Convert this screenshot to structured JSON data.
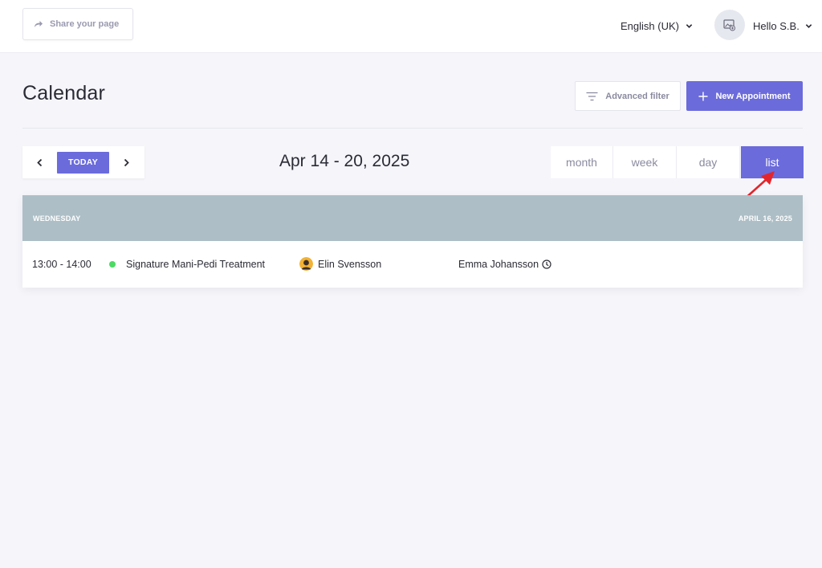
{
  "topbar": {
    "share_label": "Share your page",
    "language": "English (UK)",
    "greeting": "Hello S.B."
  },
  "header": {
    "title": "Calendar",
    "advanced_filter_label": "Advanced filter",
    "new_appointment_label": "New Appointment"
  },
  "toolbar": {
    "today_label": "TODAY",
    "date_range": "Apr 14 - 20, 2025",
    "views": [
      "month",
      "week",
      "day",
      "list"
    ],
    "active_view": "list"
  },
  "list": {
    "day_name": "WEDNESDAY",
    "day_date": "APRIL 16, 2025",
    "events": [
      {
        "time": "13:00 - 14:00",
        "title": "Signature Mani-Pedi Treatment",
        "staff": "Elin Svensson",
        "client": "Emma Johansson",
        "status_color": "#4cd964"
      }
    ]
  },
  "colors": {
    "accent": "#6b6bdc",
    "day_header": "#adbec6",
    "annotation": "#e3262b"
  },
  "icons": {
    "share": "share-arrow-icon",
    "filter": "filter-lines-icon",
    "plus": "plus-icon",
    "clock": "clock-icon"
  }
}
